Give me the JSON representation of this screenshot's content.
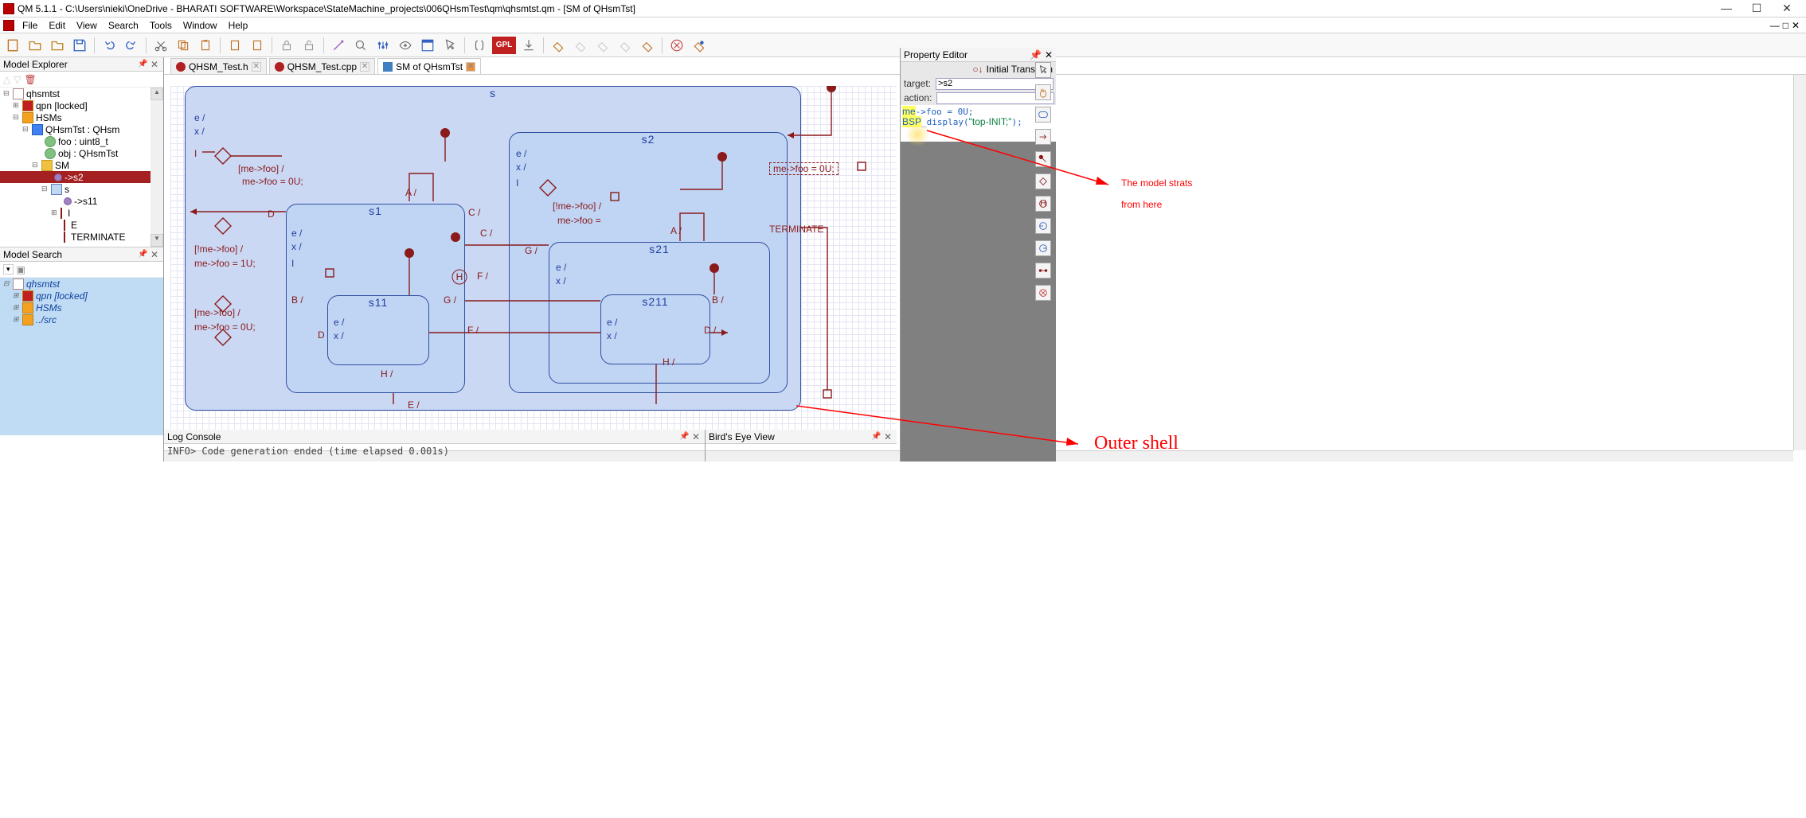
{
  "window": {
    "title": "QM 5.1.1 - C:\\Users\\nieki\\OneDrive - BHARATI SOFTWARE\\Workspace\\StateMachine_projects\\006QHsmTest\\qm\\qhsmtst.qm - [SM of QHsmTst]"
  },
  "menu": {
    "file": "File",
    "edit": "Edit",
    "view": "View",
    "search": "Search",
    "tools": "Tools",
    "window": "Window",
    "help": "Help"
  },
  "explorer": {
    "title": "Model Explorer",
    "root": "qhsmtst",
    "qpn": "qpn [locked]",
    "hsms": "HSMs",
    "class": "QHsmTst : QHsm",
    "foo": "foo : uint8_t",
    "obj": "obj : QHsmTst",
    "sm": "SM",
    "trans_s2": "->s2",
    "state_s": "s",
    "trans_s11": "->s11",
    "item_i": "I",
    "item_e": "E",
    "terminate": "TERMINATE"
  },
  "search": {
    "title": "Model Search",
    "root": "qhsmtst",
    "qpn": "qpn [locked]",
    "hsms": "HSMs",
    "src": "../src"
  },
  "tabs": {
    "t1": "QHSM_Test.h",
    "t2": "QHSM_Test.cpp",
    "t3": "SM of QHsmTst"
  },
  "diagram": {
    "s": "s",
    "s1": "s1",
    "s2": "s2",
    "s11": "s11",
    "s21": "s21",
    "s211": "s211",
    "entry": "e /",
    "exit": "x /",
    "i": "I",
    "guard1": "[me->foo] /",
    "action1": "me->foo = 0U;",
    "guard2": "[!me->foo] /",
    "action2": "me->foo = 1U;",
    "guard3": "[me->foo] /",
    "action3": "me->foo = 0U;",
    "guard4": "[!me->foo] /",
    "action4": "me->foo =",
    "D": "D",
    "A": "A /",
    "B": "B /",
    "C": "C /",
    "E": "E /",
    "F": "F /",
    "G": "G /",
    "H": "H /",
    "Dslash": "D /",
    "topinit": "me->foo = 0U;",
    "terminate": "TERMINATE"
  },
  "log": {
    "title": "Log Console",
    "line": "INFO> Code generation ended (time elapsed 0.001s)"
  },
  "bev": {
    "title": "Bird's Eye View"
  },
  "prop": {
    "title": "Property Editor",
    "type": "Initial Transition",
    "target_label": "target:",
    "target_val": ">s2",
    "action_label": "action:",
    "code1": "me->foo = 0U;",
    "code2": "BSP_display(\"top-INIT;\");"
  },
  "annotation": {
    "a1": "The model strats",
    "a1b": "from here",
    "a2": "Outer shell"
  }
}
